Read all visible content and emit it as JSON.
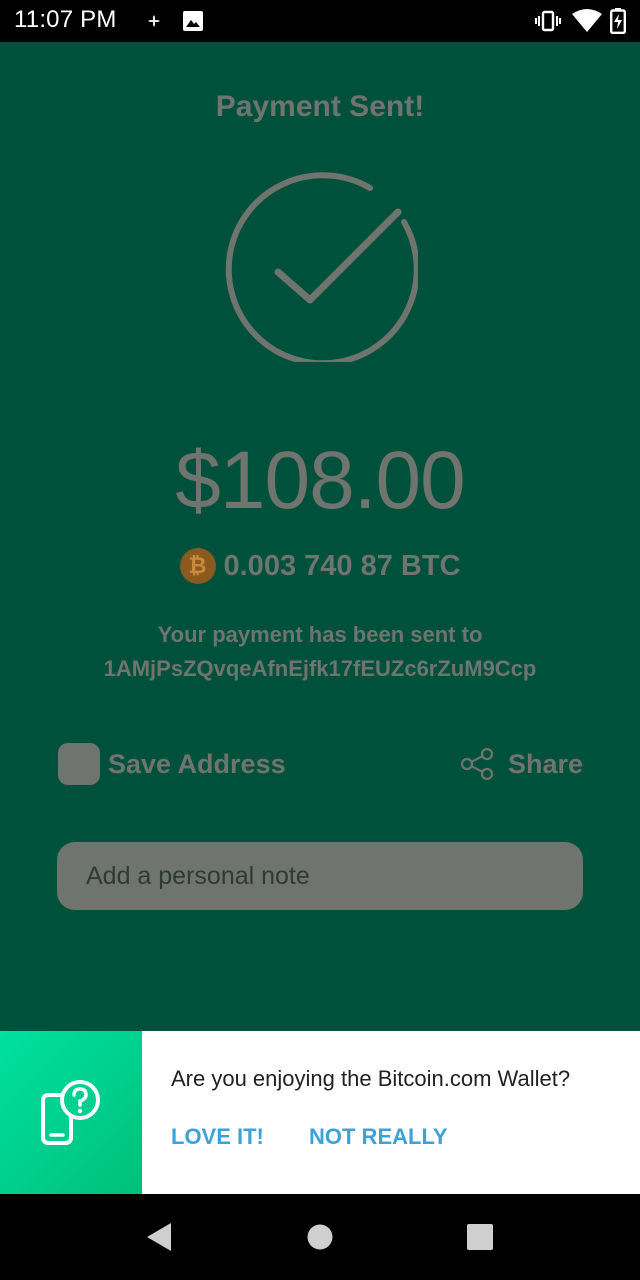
{
  "status_bar": {
    "time": "11:07 PM",
    "left_icons": [
      "fan-icon",
      "image-icon"
    ],
    "right_icons": [
      "vibrate-icon",
      "wifi-icon",
      "battery-charging-icon"
    ]
  },
  "payment": {
    "title": "Payment Sent!",
    "status_icon": "check-circle-icon",
    "fiat_amount": "$108.00",
    "btc_amount": "0.003 740 87 BTC",
    "coin_symbol": "₿",
    "sent_to_line1": "Your payment has been sent to",
    "address": "1AMjPsZQvqeAfnEjfk17fEUZc6rZuM9Ccp"
  },
  "actions": {
    "save_address_label": "Save Address",
    "share_label": "Share"
  },
  "note": {
    "placeholder": "Add a personal note",
    "value": ""
  },
  "rating_banner": {
    "question": "Are you enjoying the Bitcoin.com Wallet?",
    "love_label": "LOVE IT!",
    "not_really_label": "NOT REALLY"
  },
  "colors": {
    "background": "#00513C",
    "muted_text": "#6f746f",
    "accent_link": "#3ba3d9",
    "banner_gradient_start": "#00e0a0",
    "banner_gradient_end": "#00c07a"
  }
}
